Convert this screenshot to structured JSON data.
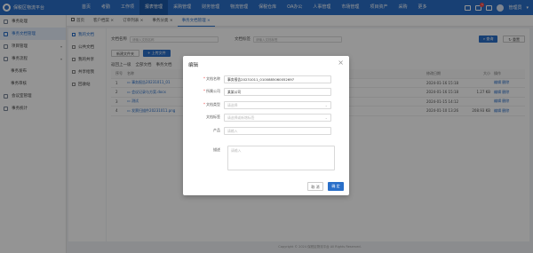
{
  "app": {
    "title": "保税区物流平台"
  },
  "topnav": {
    "items": [
      "首页",
      "考勤",
      "工作项",
      "报表管理",
      "采购管理",
      "财务管理",
      "物流管理",
      "保税仓库",
      "OA办公",
      "人事管理",
      "市场管理",
      "项目资产",
      "采购",
      "更多"
    ],
    "active": 3
  },
  "topright": {
    "badge": "1",
    "user": "管理员"
  },
  "sidebar": {
    "items": [
      {
        "label": "事务处理",
        "icon": "folder-icon",
        "sub": false,
        "active": false,
        "arrow": ""
      },
      {
        "label": "事务文档管理",
        "icon": "doc-icon",
        "sub": false,
        "active": true,
        "arrow": ""
      },
      {
        "label": "项目管理",
        "icon": "project-icon",
        "sub": false,
        "active": false,
        "arrow": "▾"
      },
      {
        "label": "事务流程",
        "icon": "flow-icon",
        "sub": false,
        "active": false,
        "arrow": "▾"
      },
      {
        "label": "事务发布",
        "icon": "publish-icon",
        "sub": true,
        "active": false,
        "arrow": ""
      },
      {
        "label": "事务审核",
        "icon": "audit-icon",
        "sub": true,
        "active": false,
        "arrow": ""
      },
      {
        "label": "会议室管理",
        "icon": "meeting-icon",
        "sub": false,
        "active": false,
        "arrow": ""
      },
      {
        "label": "事务统计",
        "icon": "stats-icon",
        "sub": false,
        "active": false,
        "arrow": ""
      }
    ]
  },
  "tabs": {
    "items": [
      "首页",
      "客户档案 ×",
      "订单列表 ×",
      "事务分类 ×",
      "事务文档管理 ×"
    ],
    "active": 4
  },
  "subsidebar": {
    "items": [
      "我的文档",
      "公共文档",
      "我的共享",
      "共享给我",
      "回收站"
    ],
    "active": 0
  },
  "search": {
    "label1": "文档名称",
    "placeholder1": "请输入文档名称",
    "label2": "文档标签",
    "placeholder2": "请输入文档标签",
    "search_btn": "查询",
    "reset_btn": "重置"
  },
  "toolbar": {
    "create_folder": "新建文件夹",
    "upload": "上传文件"
  },
  "breadcrumb": [
    "返回上一级",
    "全部文档",
    "事务文档"
  ],
  "table": {
    "headers": [
      "序号",
      "名称",
      "",
      "修改日期",
      "大小",
      "操作"
    ],
    "rows": [
      {
        "idx": "1",
        "name": "事务报告20231011_01",
        "date": "2024-01-16 15:18",
        "size": "",
        "ops": "编辑 删除"
      },
      {
        "idx": "2",
        "name": "会议记录与方案.docx",
        "date": "2024-01-16 15:18",
        "size": "1.27 KB",
        "ops": "编辑 删除"
      },
      {
        "idx": "3",
        "name": "测试",
        "date": "2024-01-15 14:12",
        "size": "",
        "ops": "编辑 删除"
      },
      {
        "idx": "4",
        "name": "发票扫描件20231011.png",
        "date": "2024-01-10 13:26",
        "size": "208.93 KB",
        "ops": "编辑 删除"
      }
    ]
  },
  "footer": "Copyright © 2024 保税区物流平台 All Rights Reserved.",
  "modal": {
    "title": "编辑",
    "fields": [
      {
        "label": "文档名称",
        "required": true,
        "value": "事务报告20231011_0100885060052697",
        "placeholder": false,
        "select": false
      },
      {
        "label": "所属公司",
        "required": true,
        "value": "某某公司",
        "placeholder": false,
        "select": false
      },
      {
        "label": "文档类型",
        "required": true,
        "value": "请选择",
        "placeholder": true,
        "select": true
      },
      {
        "label": "文档标签",
        "required": false,
        "value": "请选择或新增标签",
        "placeholder": true,
        "select": true
      },
      {
        "label": "产品",
        "required": false,
        "value": "请输入",
        "placeholder": true,
        "select": false
      }
    ],
    "desc_label": "描述",
    "desc_placeholder": "请输入",
    "cancel": "取 消",
    "ok": "确 定"
  }
}
